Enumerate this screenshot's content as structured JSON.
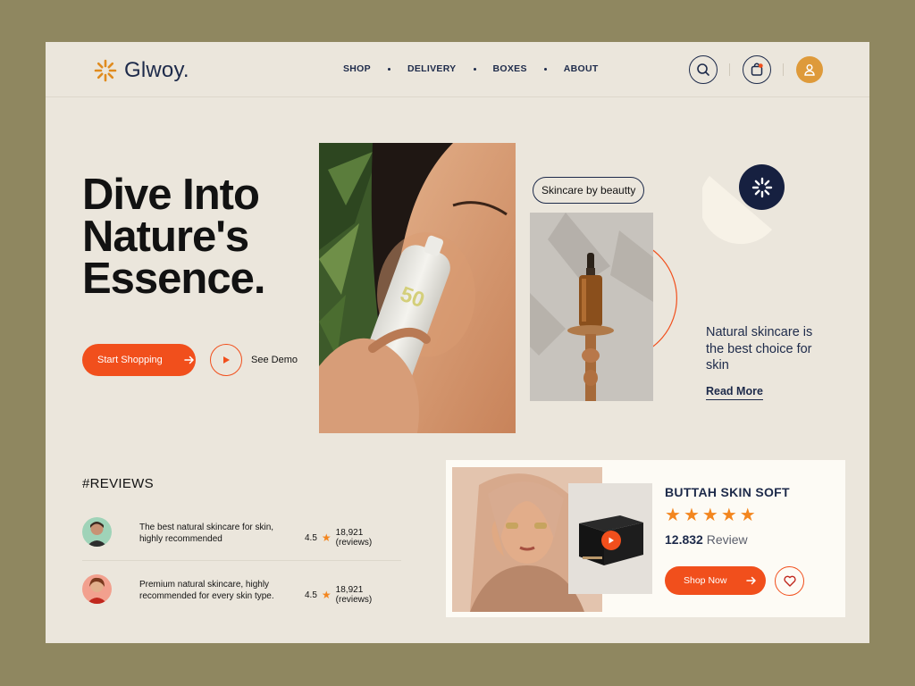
{
  "brand": {
    "name": "Glwoy."
  },
  "nav": {
    "items": [
      "SHOP",
      "DELIVERY",
      "BOXES",
      "ABOUT"
    ]
  },
  "hero": {
    "title_lines": [
      "Dive Into",
      "Nature's",
      "Essence."
    ],
    "primary_cta": "Start Shopping",
    "secondary_cta": "See Demo"
  },
  "feature": {
    "tag": "Skincare by beautty",
    "description": "Natural skincare is the best choice for skin",
    "link": "Read More"
  },
  "reviews": {
    "title": "#REVIEWS",
    "items": [
      {
        "text": "The best natural skincare for skin, highly recommended",
        "rating": "4.5",
        "count": "18,921 (reviews)"
      },
      {
        "text": "Premium natural skincare, highly recommended for every skin type.",
        "rating": "4.5",
        "count": "18,921 (reviews)"
      }
    ]
  },
  "product": {
    "name": "BUTTAH SKIN SOFT",
    "stars": 5,
    "review_number": "12.832",
    "review_label": "Review",
    "cta": "Shop Now"
  },
  "colors": {
    "accent": "#f14f1c",
    "navy": "#1d2a4a",
    "background": "#ebe6dc",
    "star": "#f3861f",
    "avatar": "#de9a3a"
  }
}
